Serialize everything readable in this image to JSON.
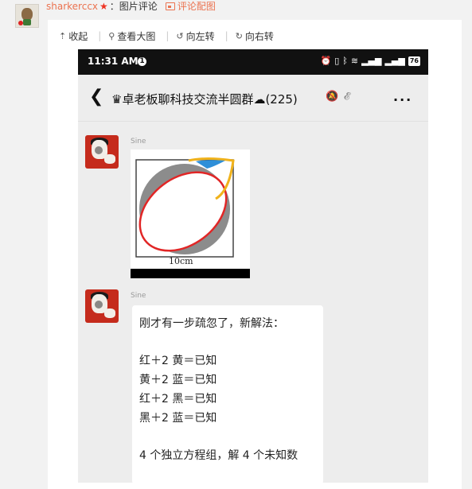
{
  "post": {
    "username": "sharkerccx",
    "separator": "：",
    "section": "图片评论",
    "attachment": "评论配图"
  },
  "toolbar": {
    "collapse": "收起",
    "view_large": "查看大图",
    "rotate_left": "向左转",
    "rotate_right": "向右转"
  },
  "phone": {
    "time": "11:31 AM",
    "alert": "1",
    "battery": "76",
    "chat_title": "♛卓老板聊科技交流半圆群",
    "member_count": "(225)",
    "more": "...",
    "messages": [
      {
        "sender": "Sine",
        "type": "image",
        "image_caption": "10cm"
      },
      {
        "sender": "Sine",
        "type": "text",
        "lines": [
          "刚才有一步疏忽了，新解法：",
          "",
          "红＋2 黄＝已知",
          "黄＋2 蓝＝已知",
          "红＋2 黑＝已知",
          "黑＋2 蓝＝已知",
          "",
          "4 个独立方程组，解 4 个未知数"
        ]
      }
    ]
  },
  "colors": {
    "accent_orange": "#eb7350",
    "page_bg": "#f2f2f2",
    "chat_bg": "#ededed",
    "avatar_red": "#c52b1c",
    "diagram_red": "#e12626",
    "diagram_blue": "#2f8fd8",
    "diagram_yellow": "#f0b21b"
  }
}
